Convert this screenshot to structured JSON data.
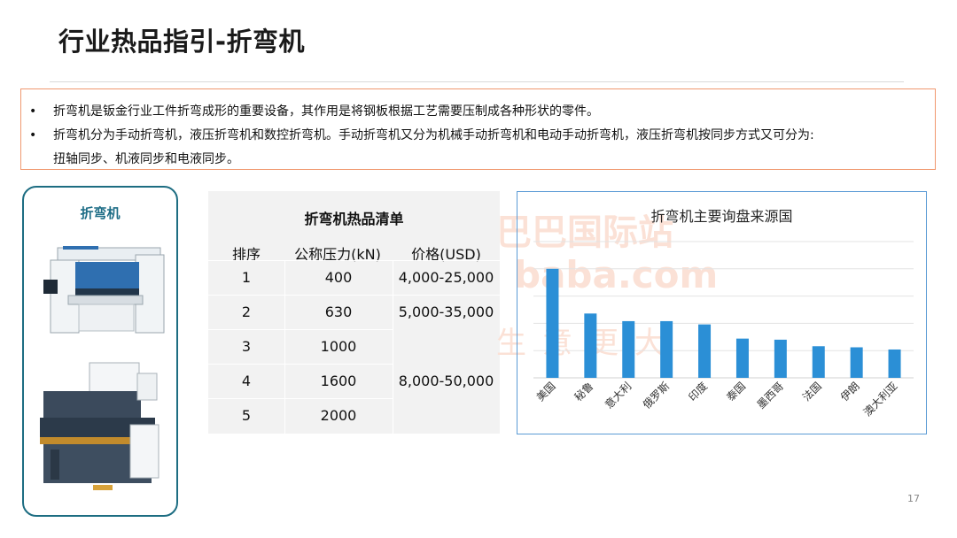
{
  "page": {
    "title": "行业热品指引-折弯机",
    "page_number": "17"
  },
  "bullets": [
    {
      "symbol": "•",
      "text": "折弯机是钣金行业工件折弯成形的重要设备，其作用是将钢板根据工艺需要压制成各种形状的零件。"
    },
    {
      "symbol": "•",
      "text": "折弯机分为手动折弯机，液压折弯机和数控折弯机。手动折弯机又分为机械手动折弯机和电动手动折弯机，液压折弯机按同步方式又可分为:"
    },
    {
      "symbol": "",
      "text": "扭轴同步、机液同步和电液同步。"
    }
  ],
  "product_card": {
    "title": "折弯机"
  },
  "hot_list": {
    "title": "折弯机热品清单",
    "headers": [
      "排序",
      "公称压力(kN)",
      "价格(USD)"
    ],
    "rows": [
      {
        "rank": "1",
        "pressure": "400",
        "price": "4,000-25,000"
      },
      {
        "rank": "2",
        "pressure": "630",
        "price": "5,000-35,000"
      },
      {
        "rank": "3",
        "pressure": "1000",
        "price": ""
      },
      {
        "rank": "4",
        "pressure": "1600",
        "price": "8,000-50,000"
      },
      {
        "rank": "5",
        "pressure": "2000",
        "price": ""
      }
    ]
  },
  "watermark": {
    "line1": "巴巴国际站",
    "line2": "baba.com",
    "line3": "生意更大"
  },
  "chart_data": {
    "type": "bar",
    "title": "折弯机主要询盘来源国",
    "categories": [
      "美国",
      "秘鲁",
      "意大利",
      "俄罗斯",
      "印度",
      "泰国",
      "墨西哥",
      "法国",
      "伊朗",
      "澳大利亚"
    ],
    "values": [
      100,
      59,
      52,
      52,
      49,
      36,
      35,
      29,
      28,
      26
    ],
    "ylim": [
      0,
      125
    ],
    "grid": true,
    "bar_color": "#2b8fd6"
  }
}
